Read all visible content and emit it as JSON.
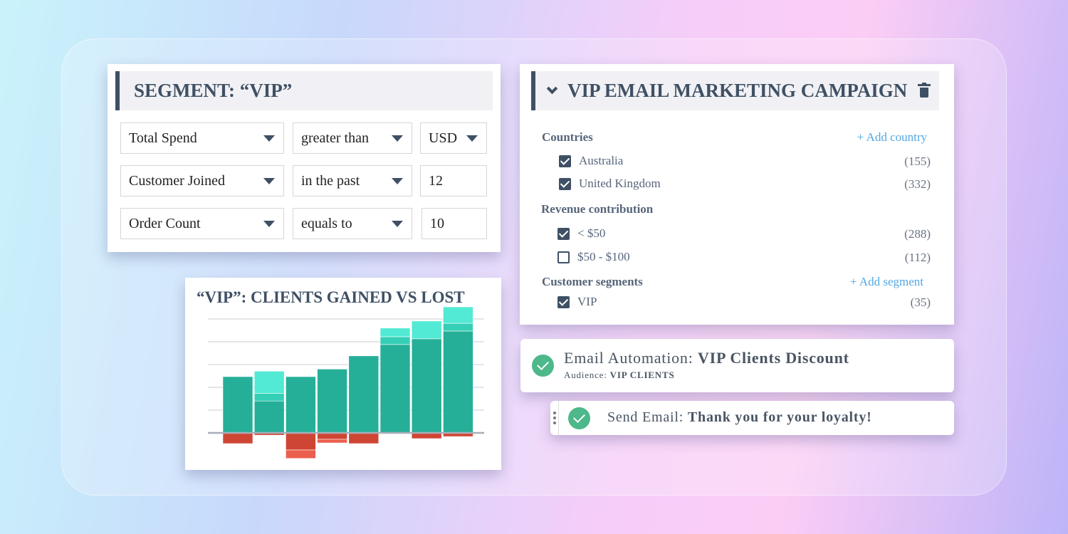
{
  "segment": {
    "title": "SEGMENT: “VIP”",
    "rules": [
      {
        "field": "Total Spend",
        "operator": "greater than",
        "value": "USD",
        "value_is_dropdown": true
      },
      {
        "field": "Customer Joined",
        "operator": "in the past",
        "value": "12",
        "value_is_dropdown": false
      },
      {
        "field": "Order Count",
        "operator": "equals to",
        "value": "10",
        "value_is_dropdown": false
      }
    ]
  },
  "campaign": {
    "title": "VIP EMAIL MARKETING CAMPAIGN",
    "icons": [
      "chevron-down-icon",
      "trash-icon"
    ],
    "countries": {
      "label": "Countries",
      "add": "+ Add country",
      "items": [
        {
          "label": "Australia",
          "count": "(155)",
          "checked": true
        },
        {
          "label": "United Kingdom",
          "count": "(332)",
          "checked": true
        }
      ]
    },
    "revenue": {
      "label": "Revenue contribution",
      "items": [
        {
          "label": "< $50",
          "count": "(288)",
          "checked": true
        },
        {
          "label": "$50 - $100",
          "count": "(112)",
          "checked": false
        }
      ]
    },
    "segments": {
      "label": "Customer segments",
      "add": "+ Add segment",
      "items": [
        {
          "label": "VIP",
          "count": "(35)",
          "checked": true
        }
      ]
    }
  },
  "automation": {
    "prefix": "Email Automation: ",
    "name": "VIP Clients Discount",
    "audience_label": "Audience: ",
    "audience": "VIP CLIENTS"
  },
  "send_email": {
    "prefix": "Send Email: ",
    "subject": "Thank you for your loyalty!"
  },
  "colors": {
    "gained_dark": "#25af98",
    "gained_mid": "#35cfb6",
    "gained_light": "#52ead4",
    "lost_dark": "#cf4533",
    "lost_light": "#ea5f4d",
    "accent": "#3f5064",
    "success": "#4db88a",
    "link": "#53a8e2"
  },
  "chart_data": {
    "type": "bar",
    "stacked": true,
    "title": "“VIP”: CLIENTS GAINED VS LOST",
    "xlabel": "",
    "ylabel": "",
    "ylim": [
      -1.2,
      5.6
    ],
    "grid": true,
    "series": [
      {
        "key": "gained_base",
        "values": [
          2.47,
          1.4,
          2.47,
          2.8,
          3.38,
          3.88,
          4.13,
          4.47
        ]
      },
      {
        "key": "gained_mid",
        "values": [
          0,
          0.34,
          0,
          0,
          0,
          0.34,
          0,
          0.34
        ]
      },
      {
        "key": "gained_top",
        "values": [
          0,
          0.97,
          0,
          0,
          0,
          0.38,
          0.78,
          0.72
        ]
      },
      {
        "key": "lost_base",
        "values": [
          -0.47,
          -0.1,
          -0.75,
          -0.28,
          -0.47,
          0,
          -0.25,
          -0.16
        ]
      },
      {
        "key": "lost_extra",
        "values": [
          0,
          0,
          -0.37,
          -0.16,
          0,
          0,
          0,
          0
        ]
      }
    ]
  }
}
